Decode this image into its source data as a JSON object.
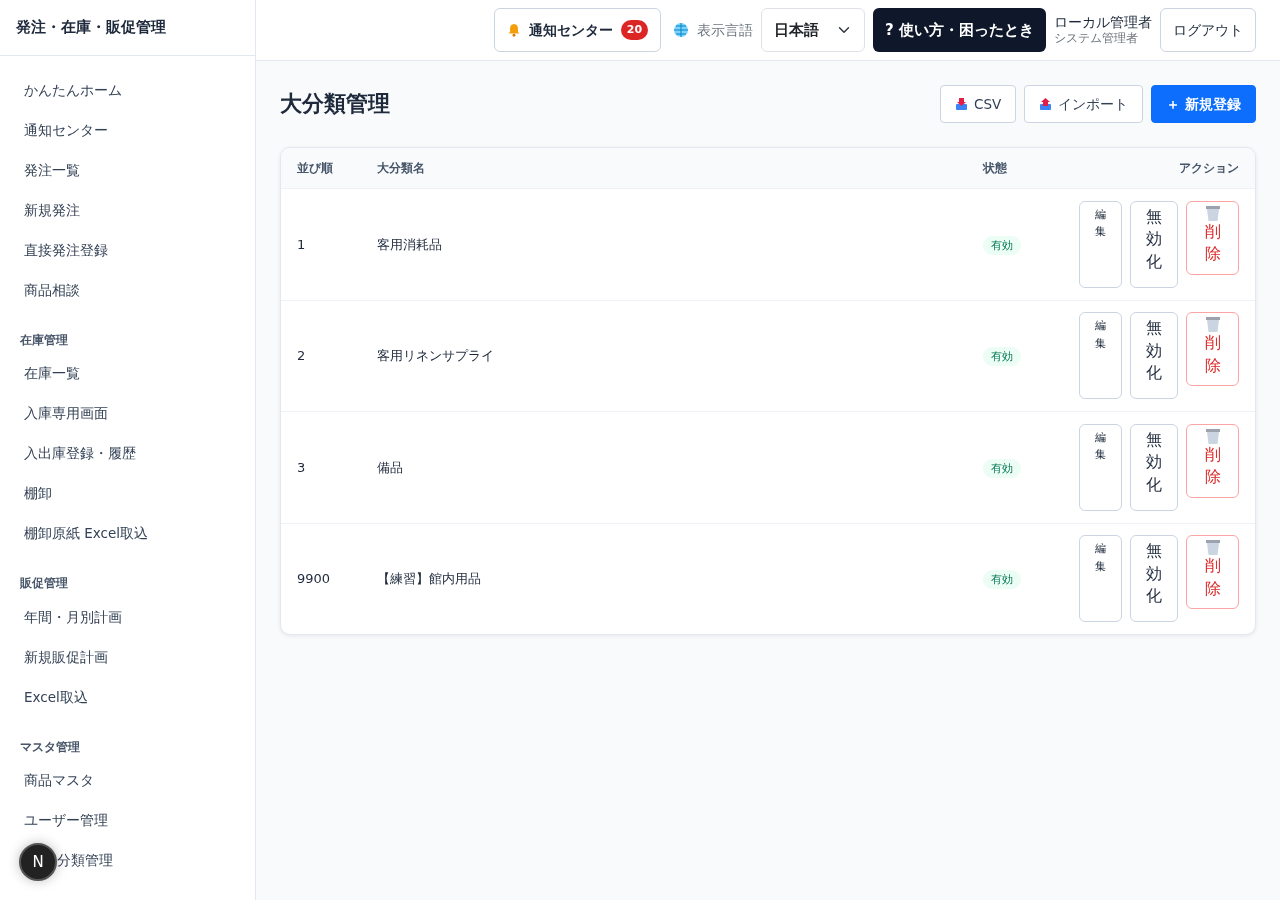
{
  "app_title": "発注・在庫・販促管理",
  "sidebar": {
    "sections": [
      {
        "items": [
          {
            "label": "かんたんホーム"
          },
          {
            "label": "通知センター"
          },
          {
            "label": "発注一覧"
          },
          {
            "label": "新規発注"
          },
          {
            "label": "直接発注登録"
          },
          {
            "label": "商品相談"
          }
        ]
      },
      {
        "heading": "在庫管理",
        "items": [
          {
            "label": "在庫一覧"
          },
          {
            "label": "入庫専用画面"
          },
          {
            "label": "入出庫登録・履歴"
          },
          {
            "label": "棚卸"
          },
          {
            "label": "棚卸原紙 Excel取込"
          }
        ]
      },
      {
        "heading": "販促管理",
        "items": [
          {
            "label": "年間・月別計画"
          },
          {
            "label": "新規販促計画"
          },
          {
            "label": "Excel取込"
          }
        ]
      },
      {
        "heading": "マスタ管理",
        "items": [
          {
            "label": "商品マスタ"
          },
          {
            "label": "ユーザー管理"
          },
          {
            "label": "分類管理",
            "covered": true
          }
        ]
      }
    ]
  },
  "floating_badge": "N",
  "topbar": {
    "notification": {
      "label": "通知センター",
      "count": "20"
    },
    "language_label": "表示言語",
    "language": "日本語",
    "help": "? 使い方・困ったとき",
    "user_name": "ローカル管理者",
    "user_role": "システム管理者",
    "logout": "ログアウト"
  },
  "page_title": "大分類管理",
  "actions": [
    {
      "kind": "csv",
      "label": "CSV"
    },
    {
      "kind": "import",
      "label": "インポート"
    },
    {
      "kind": "new",
      "label": "＋ 新規登録"
    }
  ],
  "table": {
    "columns": [
      "並び順",
      "大分類名",
      "状態",
      "アクション"
    ],
    "rows": [
      {
        "order": "1",
        "name": "客用消耗品",
        "status": "有効",
        "edit": "編集",
        "disable": "無効化",
        "delete": "削除"
      },
      {
        "order": "2",
        "name": "客用リネンサプライ",
        "status": "有効",
        "edit": "編集",
        "disable": "無効化",
        "delete": "削除"
      },
      {
        "order": "3",
        "name": "備品",
        "status": "有効",
        "edit": "編集",
        "disable": "無効化",
        "delete": "削除"
      },
      {
        "order": "9900",
        "name": "【練習】館内用品",
        "status": "有効",
        "edit": "編集",
        "disable": "無効化",
        "delete": "削除"
      }
    ]
  }
}
